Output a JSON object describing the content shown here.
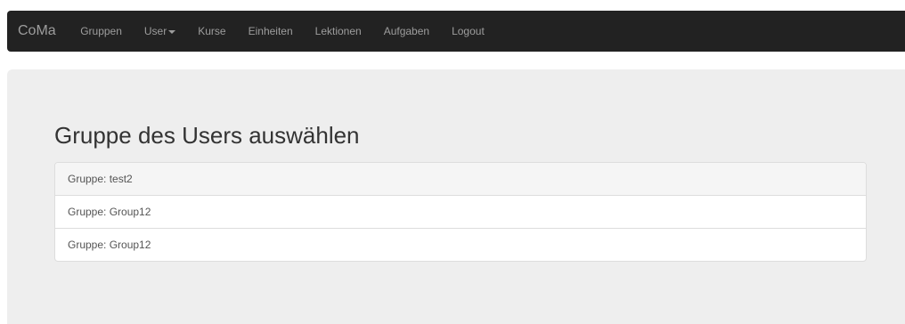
{
  "navbar": {
    "brand": "CoMa",
    "items": [
      {
        "label": "Gruppen",
        "dropdown": false
      },
      {
        "label": "User",
        "dropdown": true
      },
      {
        "label": "Kurse",
        "dropdown": false
      },
      {
        "label": "Einheiten",
        "dropdown": false
      },
      {
        "label": "Lektionen",
        "dropdown": false
      },
      {
        "label": "Aufgaben",
        "dropdown": false
      },
      {
        "label": "Logout",
        "dropdown": false
      }
    ]
  },
  "main": {
    "title": "Gruppe des Users auswählen",
    "groups": [
      {
        "label": "Gruppe: test2"
      },
      {
        "label": "Gruppe: Group12"
      },
      {
        "label": "Gruppe: Group12"
      }
    ]
  },
  "colors": {
    "navbar_bg": "#222222",
    "navbar_text": "#9d9d9d",
    "jumbotron_bg": "#eeeeee"
  }
}
